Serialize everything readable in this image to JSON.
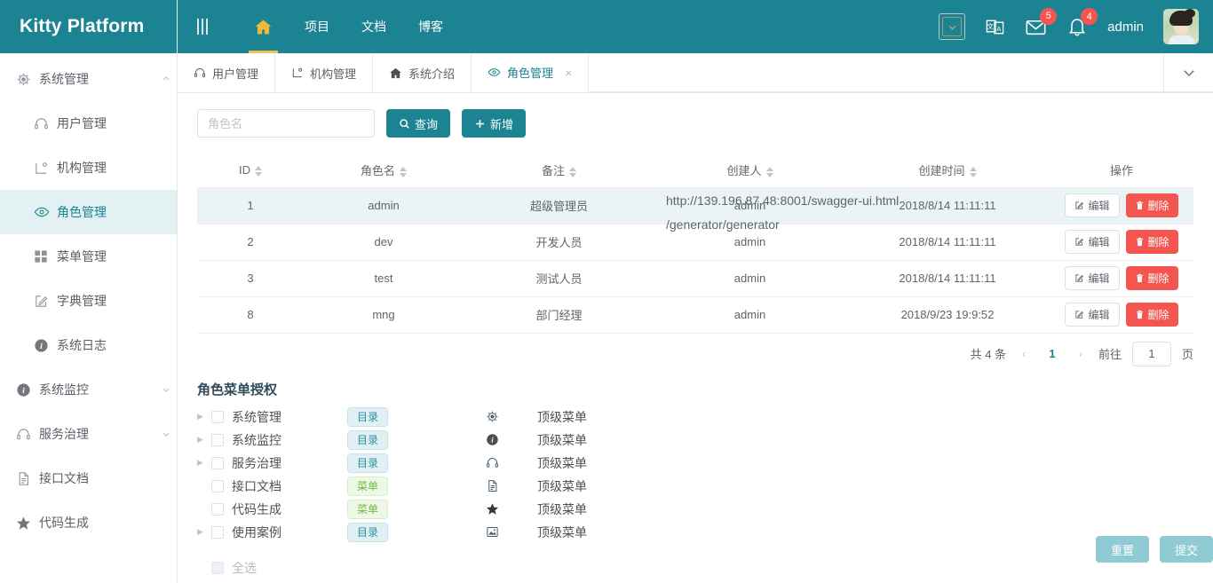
{
  "brand": {
    "title": "Kitty Platform",
    "color": "#1b8391"
  },
  "sidebar": {
    "groups": [
      {
        "label": "系统管理",
        "icon": "gear-icon",
        "expanded": true,
        "items": [
          {
            "label": "用户管理",
            "icon": "headset-icon",
            "active": false
          },
          {
            "label": "机构管理",
            "icon": "org-icon",
            "active": false
          },
          {
            "label": "角色管理",
            "icon": "eye-icon",
            "active": true
          },
          {
            "label": "菜单管理",
            "icon": "grid-icon",
            "active": false
          },
          {
            "label": "字典管理",
            "icon": "edit-square-icon",
            "active": false
          },
          {
            "label": "系统日志",
            "icon": "info-circle-icon",
            "active": false
          }
        ]
      },
      {
        "label": "系统监控",
        "icon": "info-circle-icon",
        "expanded": false,
        "items": []
      },
      {
        "label": "服务治理",
        "icon": "headset-icon",
        "expanded": false,
        "items": []
      }
    ],
    "singles": [
      {
        "label": "接口文档",
        "icon": "document-icon"
      },
      {
        "label": "代码生成",
        "icon": "star-icon"
      }
    ]
  },
  "topbar": {
    "hamburger_icon": "hamburger-icon",
    "nav": [
      {
        "label": "",
        "icon": "home-icon",
        "active": true
      },
      {
        "label": "项目",
        "icon": "",
        "active": false
      },
      {
        "label": "文档",
        "icon": "",
        "active": false
      },
      {
        "label": "博客",
        "icon": "",
        "active": false
      }
    ],
    "theme_button_icon": "chevron-down-icon",
    "lang_icon": "translate-icon",
    "mail_icon": "mail-icon",
    "mail_badge": "5",
    "bell_icon": "bell-icon",
    "bell_badge": "4",
    "username": "admin",
    "avatar_name": "avatar"
  },
  "tabs": {
    "items": [
      {
        "label": "用户管理",
        "icon": "headset-icon",
        "active": false,
        "closable": false
      },
      {
        "label": "机构管理",
        "icon": "org-icon",
        "active": false,
        "closable": false
      },
      {
        "label": "系统介绍",
        "icon": "home-solid-icon",
        "active": false,
        "closable": false
      },
      {
        "label": "角色管理",
        "icon": "eye-icon",
        "active": true,
        "closable": true
      }
    ],
    "close_glyph": "×",
    "dropdown_icon": "chevron-down-icon"
  },
  "toolbar": {
    "search_placeholder": "角色名",
    "search_value": "",
    "query_label": "查询",
    "query_icon": "search-icon",
    "add_label": "新增",
    "add_icon": "plus-icon"
  },
  "table": {
    "columns": [
      {
        "label": "ID",
        "sortable": true
      },
      {
        "label": "角色名",
        "sortable": true
      },
      {
        "label": "备注",
        "sortable": true
      },
      {
        "label": "创建人",
        "sortable": true
      },
      {
        "label": "创建时间",
        "sortable": true
      },
      {
        "label": "操作",
        "sortable": false
      }
    ],
    "rows": [
      {
        "id": "1",
        "role": "admin",
        "remark": "超级管理员",
        "creator": "admin",
        "created": "2018/8/14 11:11:11",
        "selected": true
      },
      {
        "id": "2",
        "role": "dev",
        "remark": "开发人员",
        "creator": "admin",
        "created": "2018/8/14 11:11:11",
        "selected": false
      },
      {
        "id": "3",
        "role": "test",
        "remark": "测试人员",
        "creator": "admin",
        "created": "2018/8/14 11:11:11",
        "selected": false
      },
      {
        "id": "8",
        "role": "mng",
        "remark": "部门经理",
        "creator": "admin",
        "created": "2018/9/23 19:9:52",
        "selected": false
      }
    ],
    "edit_label": "编辑",
    "edit_icon": "pencil-square-icon",
    "delete_label": "删除",
    "delete_icon": "trash-icon"
  },
  "pager": {
    "total_text": "共 4 条",
    "prev_glyph": "‹",
    "current_page": "1",
    "next_glyph": "›",
    "jump_prefix": "前往",
    "jump_value": "1",
    "jump_suffix": "页"
  },
  "auth": {
    "title": "角色菜单授权",
    "rows": [
      {
        "label": "系统管理",
        "expandable": true,
        "tag": "目录",
        "tag_type": "dir",
        "icon": "gear-icon",
        "top": "顶级菜单"
      },
      {
        "label": "系统监控",
        "expandable": true,
        "tag": "目录",
        "tag_type": "dir",
        "icon": "info-circle-icon",
        "top": "顶级菜单"
      },
      {
        "label": "服务治理",
        "expandable": true,
        "tag": "目录",
        "tag_type": "dir",
        "icon": "headset-icon",
        "top": "顶级菜单"
      },
      {
        "label": "接口文档",
        "expandable": false,
        "tag": "菜单",
        "tag_type": "menu",
        "icon": "document-icon",
        "top": "顶级菜单"
      },
      {
        "label": "代码生成",
        "expandable": false,
        "tag": "菜单",
        "tag_type": "menu",
        "icon": "star-icon",
        "top": "顶级菜单"
      },
      {
        "label": "使用案例",
        "expandable": true,
        "tag": "目录",
        "tag_type": "dir",
        "icon": "image-icon",
        "top": "顶级菜单"
      }
    ],
    "select_all_label": "全选",
    "urls": [
      "http://139.196.87.48:8001/swagger-ui.html",
      "/generator/generator"
    ],
    "reset_label": "重置",
    "submit_label": "提交"
  }
}
